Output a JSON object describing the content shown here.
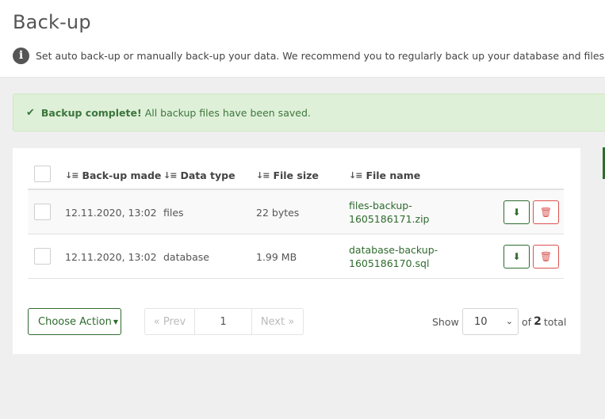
{
  "header": {
    "title": "Back-up",
    "info_text": "Set auto back-up or manually back-up your data. We recommend you to regularly back up your database and files to preve"
  },
  "alert": {
    "strong": "Backup complete!",
    "text": "All backup files have been saved."
  },
  "table": {
    "columns": {
      "made": "Back-up made",
      "type": "Data type",
      "size": "File size",
      "name": "File name"
    },
    "rows": [
      {
        "made": "12.11.2020, 13:02",
        "type": "files",
        "size": "22 bytes",
        "name": "files-backup-1605186171.zip"
      },
      {
        "made": "12.11.2020, 13:02",
        "type": "database",
        "size": "1.99 MB",
        "name": "database-backup-1605186170.sql"
      }
    ]
  },
  "footer": {
    "action_label": "Choose Action",
    "prev_label": "« Prev",
    "page_number": "1",
    "next_label": "Next »",
    "show_label": "Show",
    "per_page": "10",
    "total_prefix": "of",
    "total_count": "2",
    "total_suffix": "total"
  },
  "icons": {
    "info": "info-icon",
    "check": "check-icon",
    "sort": "sort-icon",
    "download": "download-icon",
    "trash": "trash-icon"
  },
  "colors": {
    "accent": "#2e6b2e",
    "danger": "#d9534f",
    "alert_bg": "#dff0d8"
  }
}
